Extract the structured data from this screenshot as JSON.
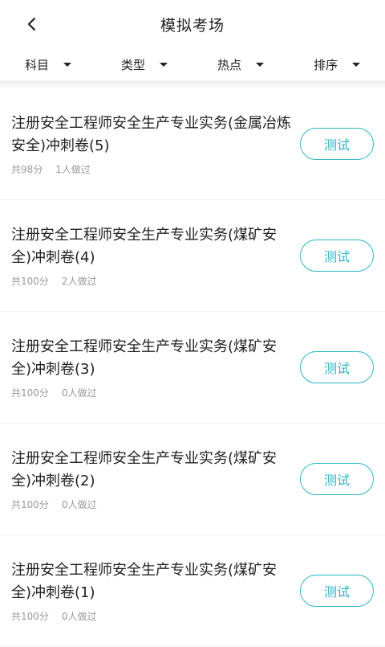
{
  "header": {
    "title": "模拟考场",
    "back_icon": "chevron-left-icon"
  },
  "filters": [
    {
      "label": "科目"
    },
    {
      "label": "类型"
    },
    {
      "label": "热点"
    },
    {
      "label": "排序"
    }
  ],
  "items": [
    {
      "title": "注册安全工程师安全生产专业实务(金属冶炼安全)冲刺卷(5)",
      "score": "共98分",
      "count": "1人做过",
      "button": "测试"
    },
    {
      "title": "注册安全工程师安全生产专业实务(煤矿安全)冲刺卷(4)",
      "score": "共100分",
      "count": "2人做过",
      "button": "测试"
    },
    {
      "title": "注册安全工程师安全生产专业实务(煤矿安全)冲刺卷(3)",
      "score": "共100分",
      "count": "0人做过",
      "button": "测试"
    },
    {
      "title": "注册安全工程师安全生产专业实务(煤矿安全)冲刺卷(2)",
      "score": "共100分",
      "count": "0人做过",
      "button": "测试"
    },
    {
      "title": "注册安全工程师安全生产专业实务(煤矿安全)冲刺卷(1)",
      "score": "共100分",
      "count": "0人做过",
      "button": "测试"
    }
  ],
  "colors": {
    "accent": "#2bb6c6",
    "meta": "#999999"
  }
}
